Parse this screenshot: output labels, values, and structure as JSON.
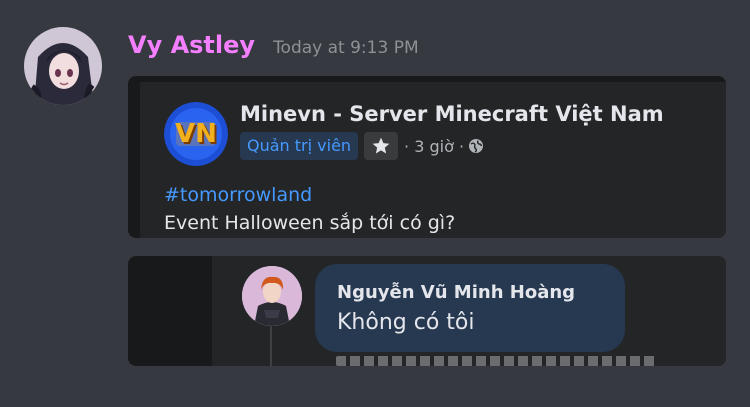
{
  "message": {
    "author": "Vy Astley",
    "timestamp": "Today at 9:13 PM"
  },
  "post": {
    "page_name": "Minevn - Server Minecraft Việt Nam",
    "logo_text": "VN",
    "admin_badge": "Quản trị viên",
    "time": "· 3 giờ ·",
    "hashtag": "#tomorrowland",
    "text": "Event Halloween sắp tới có gì?"
  },
  "comment": {
    "author": "Nguyễn Vũ Minh Hoàng",
    "text": "Không có tôi"
  },
  "colors": {
    "background": "#36393f",
    "username": "#f47fff",
    "timestamp": "#8e9297",
    "fb_blue": "#4599ff",
    "fb_card": "#242526",
    "bubble": "#263951"
  },
  "icons": {
    "star": "star-icon",
    "globe": "globe-icon"
  }
}
